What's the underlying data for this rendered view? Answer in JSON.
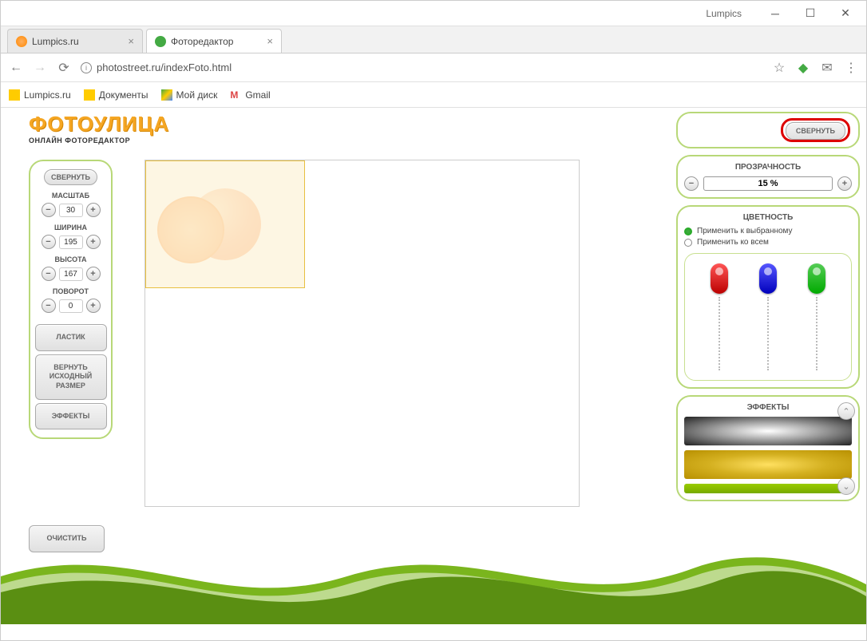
{
  "window": {
    "title": "Lumpics"
  },
  "tabs": [
    {
      "label": "Lumpics.ru"
    },
    {
      "label": "Фоторедактор"
    }
  ],
  "address": {
    "url": "photostreet.ru/indexFoto.html"
  },
  "bookmarks": [
    {
      "label": "Lumpics.ru"
    },
    {
      "label": "Документы"
    },
    {
      "label": "Мой диск"
    },
    {
      "label": "Gmail"
    }
  ],
  "logo": {
    "main": "ФОТОУЛИЦА",
    "sub": "ОНЛАЙН ФОТОРЕДАКТОР"
  },
  "left": {
    "collapse": "СВЕРНУТЬ",
    "scale": {
      "label": "МАСШТАБ",
      "value": "30"
    },
    "width": {
      "label": "ШИРИНА",
      "value": "195"
    },
    "height": {
      "label": "ВЫСОТА",
      "value": "167"
    },
    "rotate": {
      "label": "ПОВОРОТ",
      "value": "0"
    },
    "eraser": "ЛАСТИК",
    "restore": "ВЕРНУТЬ ИСХОДНЫЙ РАЗМЕР",
    "effects": "ЭФФЕКТЫ",
    "clear": "ОЧИСТИТЬ"
  },
  "right": {
    "collapse": "СВЕРНУТЬ",
    "opacity": {
      "title": "ПРОЗРАЧНОСТЬ",
      "value": "15 %"
    },
    "color": {
      "title": "ЦВЕТНОСТЬ",
      "opt_selected": "Применить к выбранному",
      "opt_all": "Применить ко всем"
    },
    "effects_title": "ЭФФЕКТЫ"
  }
}
